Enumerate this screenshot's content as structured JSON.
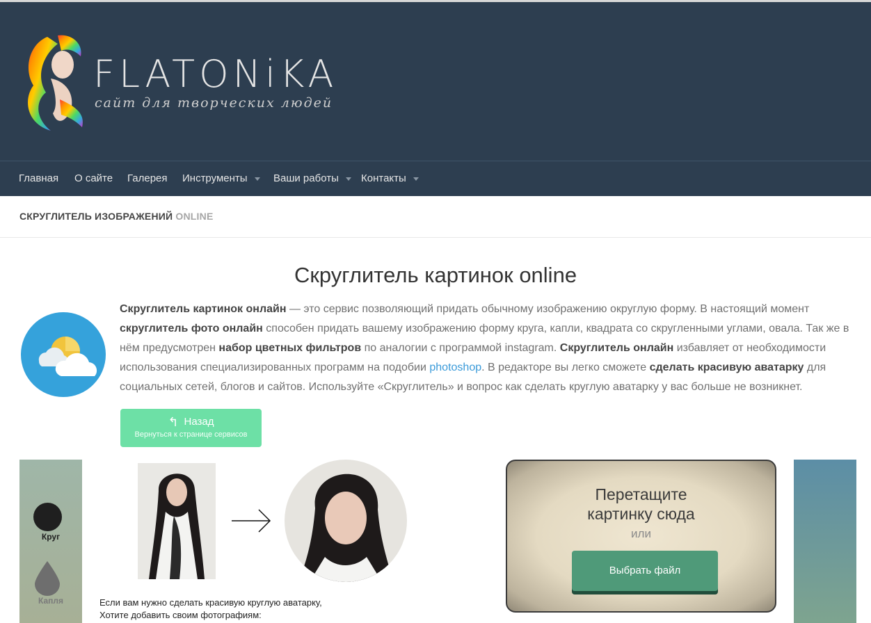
{
  "header": {
    "logo_title": "FLATONiKA",
    "logo_tagline": "сайт для творческих людей"
  },
  "nav": {
    "items": [
      {
        "label": "Главная",
        "has_dropdown": false
      },
      {
        "label": "О сайте",
        "has_dropdown": false
      },
      {
        "label": "Галерея",
        "has_dropdown": false
      },
      {
        "label": "Инструменты",
        "has_dropdown": true
      },
      {
        "label": "Ваши работы",
        "has_dropdown": true
      },
      {
        "label": "Контакты",
        "has_dropdown": true
      }
    ]
  },
  "breadcrumb": {
    "main": "СКРУГЛИТЕЛЬ ИЗОБРАЖЕНИЙ",
    "suffix": "ONLINE"
  },
  "main": {
    "title": "Скруглитель картинок online",
    "intro": {
      "p1_bold": "Скруглитель картинок онлайн",
      "p1_text": " — это сервис позволяющий придать обычному изображению округлую форму.  В настоящий момент ",
      "p2_bold": "скруглитель фото онлайн",
      "p2_text": " способен придать вашему изображению форму круга, капли, квадрата со скругленными углами, овала. Так же в нём предусмотрен ",
      "p3_bold": "набор цветных фильтров",
      "p3_text": " по аналогии с программой instagram.  ",
      "p4_bold": "Скруглитель онлайн",
      "p4_text": " избавляет от необходимости использования специализированных программ на подобии ",
      "link": "photoshop",
      "p5_text": ". В редакторе вы легко сможете ",
      "p5_bold": "сделать красивую аватарку",
      "p6_text": " для социальных сетей, блогов и  сайтов. Используйте «Скруглитель» и вопрос как сделать круглую аватарку у вас больше не возникнет."
    },
    "back_button": {
      "label": "Назад",
      "sublabel": "Вернуться к странице сервисов"
    }
  },
  "shapes": {
    "items": [
      {
        "label": "Круг"
      },
      {
        "label": "Капля"
      }
    ]
  },
  "demo": {
    "caption_line1": "Если вам нужно сделать красивую круглую аватарку,",
    "caption_line2": "Хотите добавить своим фотографиям:"
  },
  "dropzone": {
    "title_line1": "Перетащите",
    "title_line2": "картинку сюда",
    "or": "или",
    "button": "Выбрать файл"
  },
  "colors": {
    "header_bg": "#2d3e50",
    "back_button": "#6de0a6",
    "choose_button": "#4f9a79",
    "link": "#3a9ad9"
  }
}
